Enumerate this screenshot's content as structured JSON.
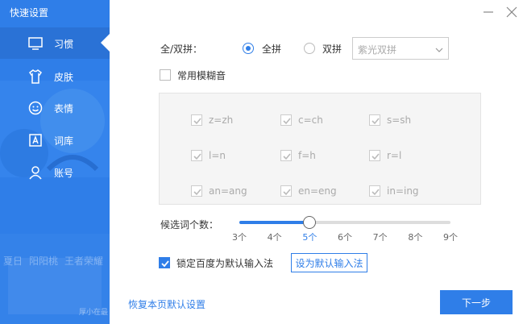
{
  "sidebar": {
    "title": "快速设置",
    "items": [
      {
        "label": "习惯",
        "icon": "monitor-icon",
        "active": true
      },
      {
        "label": "皮肤",
        "icon": "shirt-icon",
        "active": false
      },
      {
        "label": "表情",
        "icon": "smiley-icon",
        "active": false
      },
      {
        "label": "词库",
        "icon": "lexicon-icon",
        "active": false
      },
      {
        "label": "账号",
        "icon": "user-icon",
        "active": false
      }
    ],
    "background_categories": [
      "夏日",
      "阳阳桃",
      "王者荣耀"
    ],
    "background_small_text": "厚小在最"
  },
  "window": {
    "minimize_icon": "minimize-icon",
    "close_icon": "close-icon"
  },
  "pinyin_mode": {
    "label": "全/双拼：",
    "options": [
      {
        "label": "全拼",
        "selected": true
      },
      {
        "label": "双拼",
        "selected": false
      }
    ],
    "scheme_select": {
      "value": "紫光双拼",
      "enabled": false
    }
  },
  "fuzzy": {
    "label": "常用模糊音",
    "checked": false,
    "pairs": [
      {
        "label": "z=zh",
        "checked": true
      },
      {
        "label": "c=ch",
        "checked": true
      },
      {
        "label": "s=sh",
        "checked": true
      },
      {
        "label": "l=n",
        "checked": true
      },
      {
        "label": "f=h",
        "checked": true
      },
      {
        "label": "r=l",
        "checked": true
      },
      {
        "label": "an=ang",
        "checked": true
      },
      {
        "label": "en=eng",
        "checked": true
      },
      {
        "label": "in=ing",
        "checked": true
      }
    ]
  },
  "candidates": {
    "label": "候选词个数：",
    "ticks": [
      "3个",
      "4个",
      "5个",
      "6个",
      "7个",
      "8个",
      "9个"
    ],
    "selected_index": 2
  },
  "default_ime": {
    "checkbox_label": "锁定百度为默认输入法",
    "checked": true,
    "button_label": "设为默认输入法"
  },
  "footer": {
    "restore_label": "恢复本页默认设置",
    "next_label": "下一步"
  },
  "colors": {
    "accent": "#2f7ee8"
  }
}
